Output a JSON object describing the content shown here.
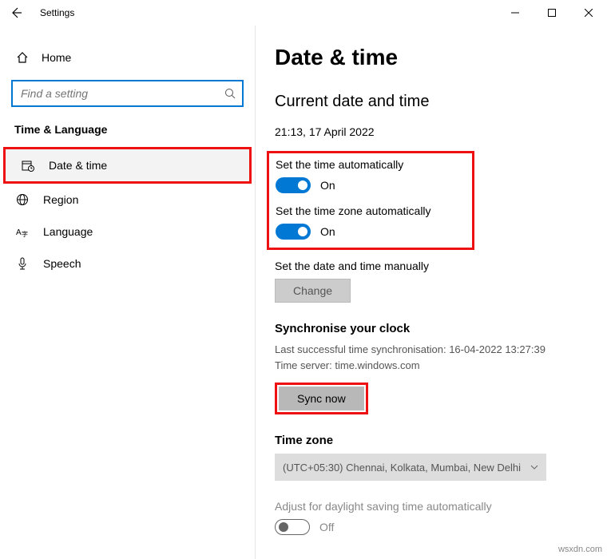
{
  "titlebar": {
    "title": "Settings"
  },
  "sidebar": {
    "home": "Home",
    "search_placeholder": "Find a setting",
    "category": "Time & Language",
    "items": [
      {
        "label": "Date & time"
      },
      {
        "label": "Region"
      },
      {
        "label": "Language"
      },
      {
        "label": "Speech"
      }
    ]
  },
  "content": {
    "heading": "Date & time",
    "subheading": "Current date and time",
    "datetime": "21:13, 17 April 2022",
    "auto_time": {
      "label": "Set the time automatically",
      "state": "On"
    },
    "auto_tz": {
      "label": "Set the time zone automatically",
      "state": "On"
    },
    "manual": {
      "label": "Set the date and time manually",
      "button": "Change"
    },
    "sync": {
      "title": "Synchronise your clock",
      "last": "Last successful time synchronisation: 16-04-2022 13:27:39",
      "server": "Time server: time.windows.com",
      "button": "Sync now"
    },
    "timezone": {
      "title": "Time zone",
      "value": "(UTC+05:30) Chennai, Kolkata, Mumbai, New Delhi"
    },
    "dst": {
      "label": "Adjust for daylight saving time automatically",
      "state": "Off"
    }
  },
  "watermark": "wsxdn.com"
}
